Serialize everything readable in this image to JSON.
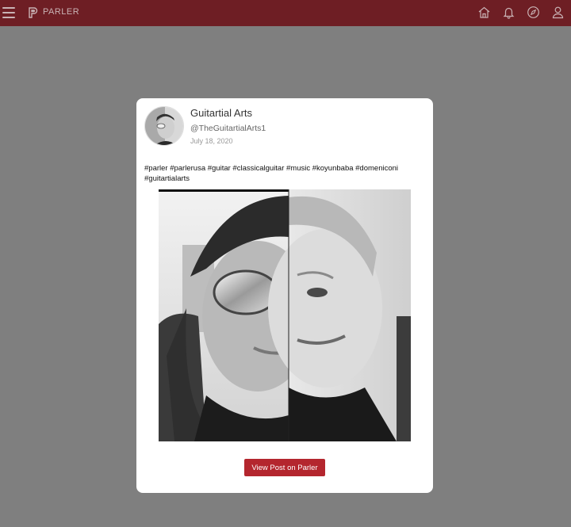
{
  "topbar": {
    "brand": "PARLER",
    "icons": [
      "menu-icon",
      "parler-logo-icon",
      "home-icon",
      "bell-icon",
      "compass-icon",
      "user-icon"
    ],
    "colors": {
      "bar": "#6e1e24",
      "iconTint": "#c9b3b5"
    }
  },
  "post": {
    "author_name": "Guitartial Arts",
    "handle": "@TheGuitartialArts1",
    "date": "July 18, 2020",
    "text": "#parler #parlerusa #guitar #classicalguitar #music #koyunbaba #domeniconi #guitartialarts",
    "button_label": "View Post on Parler",
    "colors": {
      "button": "#b4262e",
      "card": "#ffffff",
      "backdrop": "#7f7f7f"
    }
  }
}
